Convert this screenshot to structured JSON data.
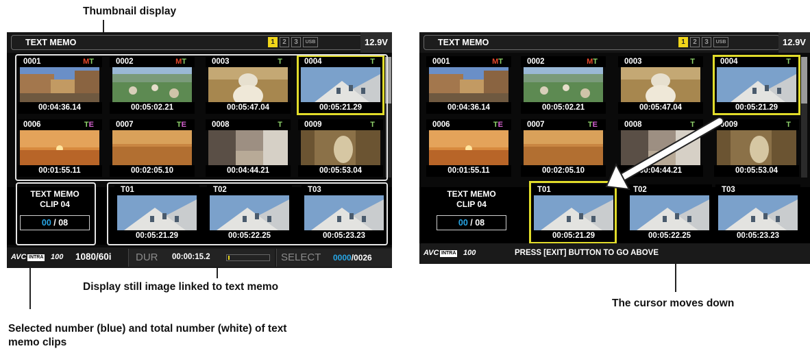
{
  "callouts": {
    "thumbnail_display": "Thumbnail display",
    "still_image": "Display still image linked to text memo",
    "selected_number_line1": "Selected number (blue) and total number (white) of text",
    "selected_number_line2": "memo clips",
    "cursor_moves": "The cursor moves down"
  },
  "screens": [
    {
      "title": "TEXT MEMO",
      "slots": [
        "1",
        "2",
        "3",
        "USB"
      ],
      "active_slot": "1",
      "voltage": "12.9V",
      "clips": [
        {
          "id": "0001",
          "badge": "MT",
          "tc": "00:04:36.14"
        },
        {
          "id": "0002",
          "badge": "MT",
          "tc": "00:05:02.21"
        },
        {
          "id": "0003",
          "badge": "T",
          "tc": "00:05:47.04"
        },
        {
          "id": "0004",
          "badge": "T",
          "tc": "00:05:21.29"
        },
        {
          "id": "0006",
          "badge": "TE",
          "tc": "00:01:55.11"
        },
        {
          "id": "0007",
          "badge": "TE",
          "tc": "00:02:05.10"
        },
        {
          "id": "0008",
          "badge": "T",
          "tc": "00:04:44.21"
        },
        {
          "id": "0009",
          "badge": "T",
          "tc": "00:05:53.04"
        }
      ],
      "memo_label": "TEXT MEMO",
      "memo_clip": "CLIP 04",
      "memo_selected": "00",
      "memo_total": "/ 08",
      "memos": [
        {
          "id": "T01",
          "tc": "00:05:21.29"
        },
        {
          "id": "T02",
          "tc": "00:05:22.25"
        },
        {
          "id": "T03",
          "tc": "00:05:23.23"
        }
      ],
      "format": "1080/60i",
      "dur_label": "DUR",
      "dur_value": "00:00:15.2",
      "meter_level": 0.04,
      "select_label": "SELECT",
      "select_selected": "0000",
      "select_total": "/0026"
    },
    {
      "title": "TEXT MEMO",
      "slots": [
        "1",
        "2",
        "3",
        "USB"
      ],
      "active_slot": "1",
      "voltage": "12.9V",
      "clips": [
        {
          "id": "0001",
          "badge": "MT",
          "tc": "00:04:36.14"
        },
        {
          "id": "0002",
          "badge": "MT",
          "tc": "00:05:02.21"
        },
        {
          "id": "0003",
          "badge": "T",
          "tc": "00:05:47.04"
        },
        {
          "id": "0004",
          "badge": "T",
          "tc": "00:05:21.29"
        },
        {
          "id": "0006",
          "badge": "TE",
          "tc": "00:01:55.11"
        },
        {
          "id": "0007",
          "badge": "TE",
          "tc": "00:02:05.10"
        },
        {
          "id": "0008",
          "badge": "T",
          "tc": "00:04:44.21"
        },
        {
          "id": "0009",
          "badge": "T",
          "tc": "00:05:53.04"
        }
      ],
      "memo_label": "TEXT MEMO",
      "memo_clip": "CLIP 04",
      "memo_selected": "00",
      "memo_total": "/ 08",
      "memos": [
        {
          "id": "T01",
          "tc": "00:05:21.29"
        },
        {
          "id": "T02",
          "tc": "00:05:22.25"
        },
        {
          "id": "T03",
          "tc": "00:05:23.23"
        }
      ],
      "press_message": "PRESS [EXIT] BUTTON TO GO ABOVE"
    }
  ],
  "colors": {
    "selection": "#e1dc2a",
    "selected_number": "#27a6e6",
    "badge_M": "#e8482c",
    "badge_T": "#8fd36b",
    "badge_E": "#d560d0",
    "slot_active": "#f1d61a"
  }
}
